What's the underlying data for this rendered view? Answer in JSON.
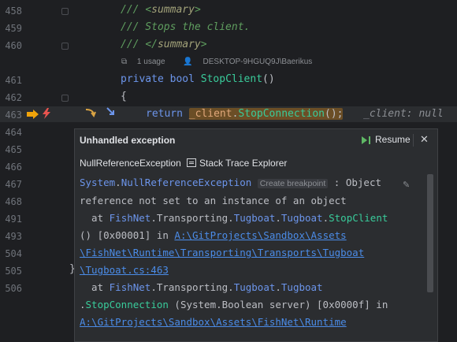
{
  "lines": [
    {
      "num": "458"
    },
    {
      "num": "459"
    },
    {
      "num": "460"
    },
    {
      "num": "461"
    },
    {
      "num": "462"
    },
    {
      "num": "463"
    },
    {
      "num": "464"
    },
    {
      "num": "465"
    },
    {
      "num": "466"
    },
    {
      "num": "467"
    },
    {
      "num": "468"
    },
    {
      "num": "491"
    },
    {
      "num": "493"
    },
    {
      "num": "504"
    },
    {
      "num": "505"
    },
    {
      "num": "506"
    }
  ],
  "code": {
    "l458_slashes": "/// ",
    "l458_open": "<",
    "l458_tag": "summary",
    "l458_close": ">",
    "l459": "/// Stops the client.",
    "l460_slashes": "/// ",
    "l460_open": "</",
    "l460_tag": "summary",
    "l460_close": ">",
    "l461_kw1": "private",
    "l461_kw2": "bool",
    "l461_fn": "StopClient",
    "l461_paren": "()",
    "l462": "{",
    "l463_return": "return",
    "l463_field": "_client",
    "l463_dot": ".",
    "l463_call": "StopConnection",
    "l463_end": "();",
    "inline_value": "_client: null",
    "brace_close": "}"
  },
  "hints": {
    "usages": "1 usage",
    "author": "DESKTOP-9HGUQ9J\\Baerikus"
  },
  "popup": {
    "title": "Unhandled exception",
    "resume": "Resume",
    "close": "✕",
    "exception_type": "NullReferenceException",
    "stack_trace_explorer": "Stack Trace Explorer",
    "create_breakpoint": "Create breakpoint",
    "trace": {
      "l1_ns": "System",
      "l1_dot": ".",
      "l1_type": "NullReferenceException",
      "l1_rest": ": Object",
      "l2": "reference not set to an instance of an object",
      "l3_at": "  at ",
      "l3_a": "FishNet",
      "l3_b": ".Transporting.",
      "l3_c": "Tugboat",
      "l3_d": ".",
      "l3_e": "Tugboat",
      "l3_f": ".",
      "l3_g": "StopClient",
      "l4_pre": "() [0x00001] in ",
      "l4_link": "A:\\GitProjects\\Sandbox\\Assets",
      "l5_link": "\\FishNet\\Runtime\\Transporting\\Transports\\Tugboat",
      "l6_link": "\\Tugboat.cs:463",
      "l7_at": "  at ",
      "l7_a": "FishNet",
      "l7_b": ".Transporting.",
      "l7_c": "Tugboat",
      "l7_d": ".",
      "l7_e": "Tugboat",
      "l8_a": ".",
      "l8_b": "StopConnection",
      "l8_c": " (System.Boolean server) [0x0000f] in",
      "l9_link": "A:\\GitProjects\\Sandbox\\Assets\\FishNet\\Runtime"
    }
  },
  "colors": {
    "background": "#1e1f22",
    "popup_bg": "#2b2d30",
    "keyword": "#6c95eb",
    "function": "#39cc9b",
    "comment": "#5f9e5f",
    "link": "#4b8ce8",
    "highlight": "#6b4e26",
    "exec_arrow": "#f0a30a",
    "resume_green": "#5fb865"
  }
}
